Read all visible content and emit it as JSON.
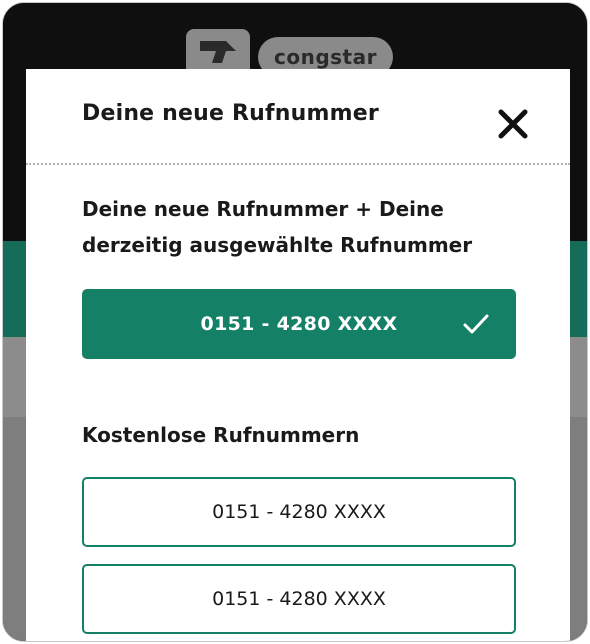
{
  "brand": {
    "logo_text": "congstar"
  },
  "modal": {
    "title": "Deine neue Rufnummer",
    "selected_section": {
      "heading": "Deine neue Rufnummer + Deine derzeitig ausgewählte Rufnummer",
      "number": "0151 - 4280 XXXX"
    },
    "free_section": {
      "heading": "Kostenlose Rufnummern",
      "numbers": [
        "0151 - 4280 XXXX",
        "0151 - 4280 XXXX"
      ]
    }
  },
  "colors": {
    "accent": "#148066",
    "background_teal": "#146c59"
  },
  "icons": {
    "close": "close-icon",
    "check": "checkmark-icon",
    "logo": "congstar-logo-icon"
  }
}
